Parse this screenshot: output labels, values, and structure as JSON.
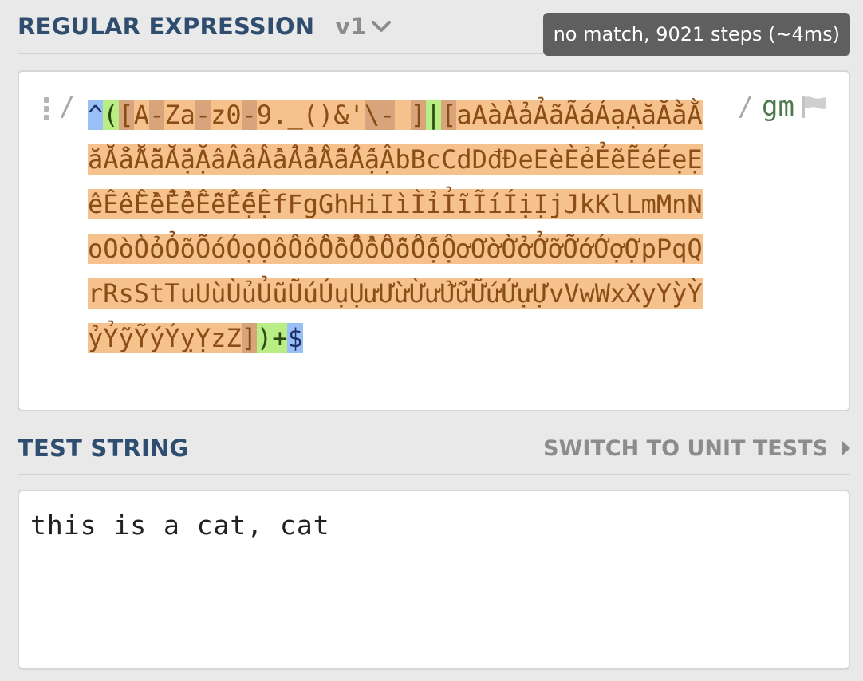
{
  "regex_section": {
    "title": "REGULAR EXPRESSION",
    "version": "v1",
    "status": "no match, 9021 steps (~4ms)",
    "delimiter_open": "/",
    "flags_delimiter": "/",
    "flags": "gm",
    "pattern_tokens": [
      {
        "text": "^",
        "type": "anchor"
      },
      {
        "text": "(",
        "type": "group"
      },
      {
        "text": "[",
        "type": "range"
      },
      {
        "text": "A",
        "type": "set"
      },
      {
        "text": "-",
        "type": "range"
      },
      {
        "text": "Za",
        "type": "set"
      },
      {
        "text": "-",
        "type": "range"
      },
      {
        "text": "z0",
        "type": "set"
      },
      {
        "text": "-",
        "type": "range"
      },
      {
        "text": "9._()&'",
        "type": "set"
      },
      {
        "text": "\\-",
        "type": "range"
      },
      {
        "text": " ",
        "type": "set"
      },
      {
        "text": "]",
        "type": "range"
      },
      {
        "text": "|",
        "type": "alt"
      },
      {
        "text": "[",
        "type": "range"
      },
      {
        "text": "aAàÀảẢãÃáÁạẠăĂằẰẳẲẵẴắẮặẶâÂầẦẩẨẫẪấẤậẬbBcCdDđĐeEèÈẻẺẽẼéÉẹẸêÊềỀểỂễỄếẾệỆfFgGhHiIìÌỉỈĩĨíÍịỊjJkKlLmMnNoOòÒỏỎõÕóÓọỌôÔồỒổỔỗỖốỐộỘơƠờỜởỞỡỠớỚợỢpPqQrRsStTuUùÙủỦũŨúÚụỤưƯừỪửỬữỮứỨựỰvVwWxXyYỳỲỷỶỹỸýÝỵỴzZ",
        "type": "set"
      },
      {
        "text": "]",
        "type": "range"
      },
      {
        "text": ")",
        "type": "group"
      },
      {
        "text": "+",
        "type": "group"
      },
      {
        "text": "$",
        "type": "anchor"
      }
    ]
  },
  "test_section": {
    "title": "TEST STRING",
    "switch_label": "SWITCH TO UNIT TESTS",
    "test_string": "this is a cat, cat"
  },
  "colors": {
    "header_title": "#2f4d6f",
    "anchor": "#99bff7",
    "group": "#b9ee86",
    "char_set": "#f5c18d",
    "range_op": "#d8a47b",
    "badge": "#5f5f5f"
  },
  "icons": [
    "chevron-down-icon",
    "drag-handle-icon",
    "flag-icon",
    "chevron-right-icon"
  ]
}
